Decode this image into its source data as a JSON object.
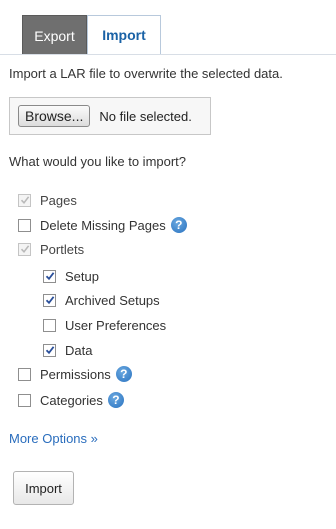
{
  "tabs": {
    "export": "Export",
    "import": "Import"
  },
  "description": "Import a LAR file to overwrite the selected data.",
  "file": {
    "browse_label": "Browse...",
    "status": "No file selected."
  },
  "question": "What would you like to import?",
  "options": {
    "pages": {
      "label": "Pages",
      "checked": true,
      "disabled": true
    },
    "delete_missing_pages": {
      "label": "Delete Missing Pages",
      "checked": false,
      "help_icon": "help-icon"
    },
    "portlets": {
      "label": "Portlets",
      "checked": true,
      "disabled": true
    },
    "setup": {
      "label": "Setup",
      "checked": true
    },
    "archived_setups": {
      "label": "Archived Setups",
      "checked": true
    },
    "user_preferences": {
      "label": "User Preferences",
      "checked": false
    },
    "data": {
      "label": "Data",
      "checked": true
    },
    "permissions": {
      "label": "Permissions",
      "checked": false,
      "help_icon": "help-icon"
    },
    "categories": {
      "label": "Categories",
      "checked": false,
      "help_icon": "help-icon"
    }
  },
  "help_glyph": "?",
  "more_options": "More Options »",
  "import_button": "Import",
  "colors": {
    "link": "#2a6dbd",
    "tab_active_text": "#1a62a6",
    "tab_inactive_bg": "#6f6f6f",
    "help_icon": "#2a73c0"
  }
}
